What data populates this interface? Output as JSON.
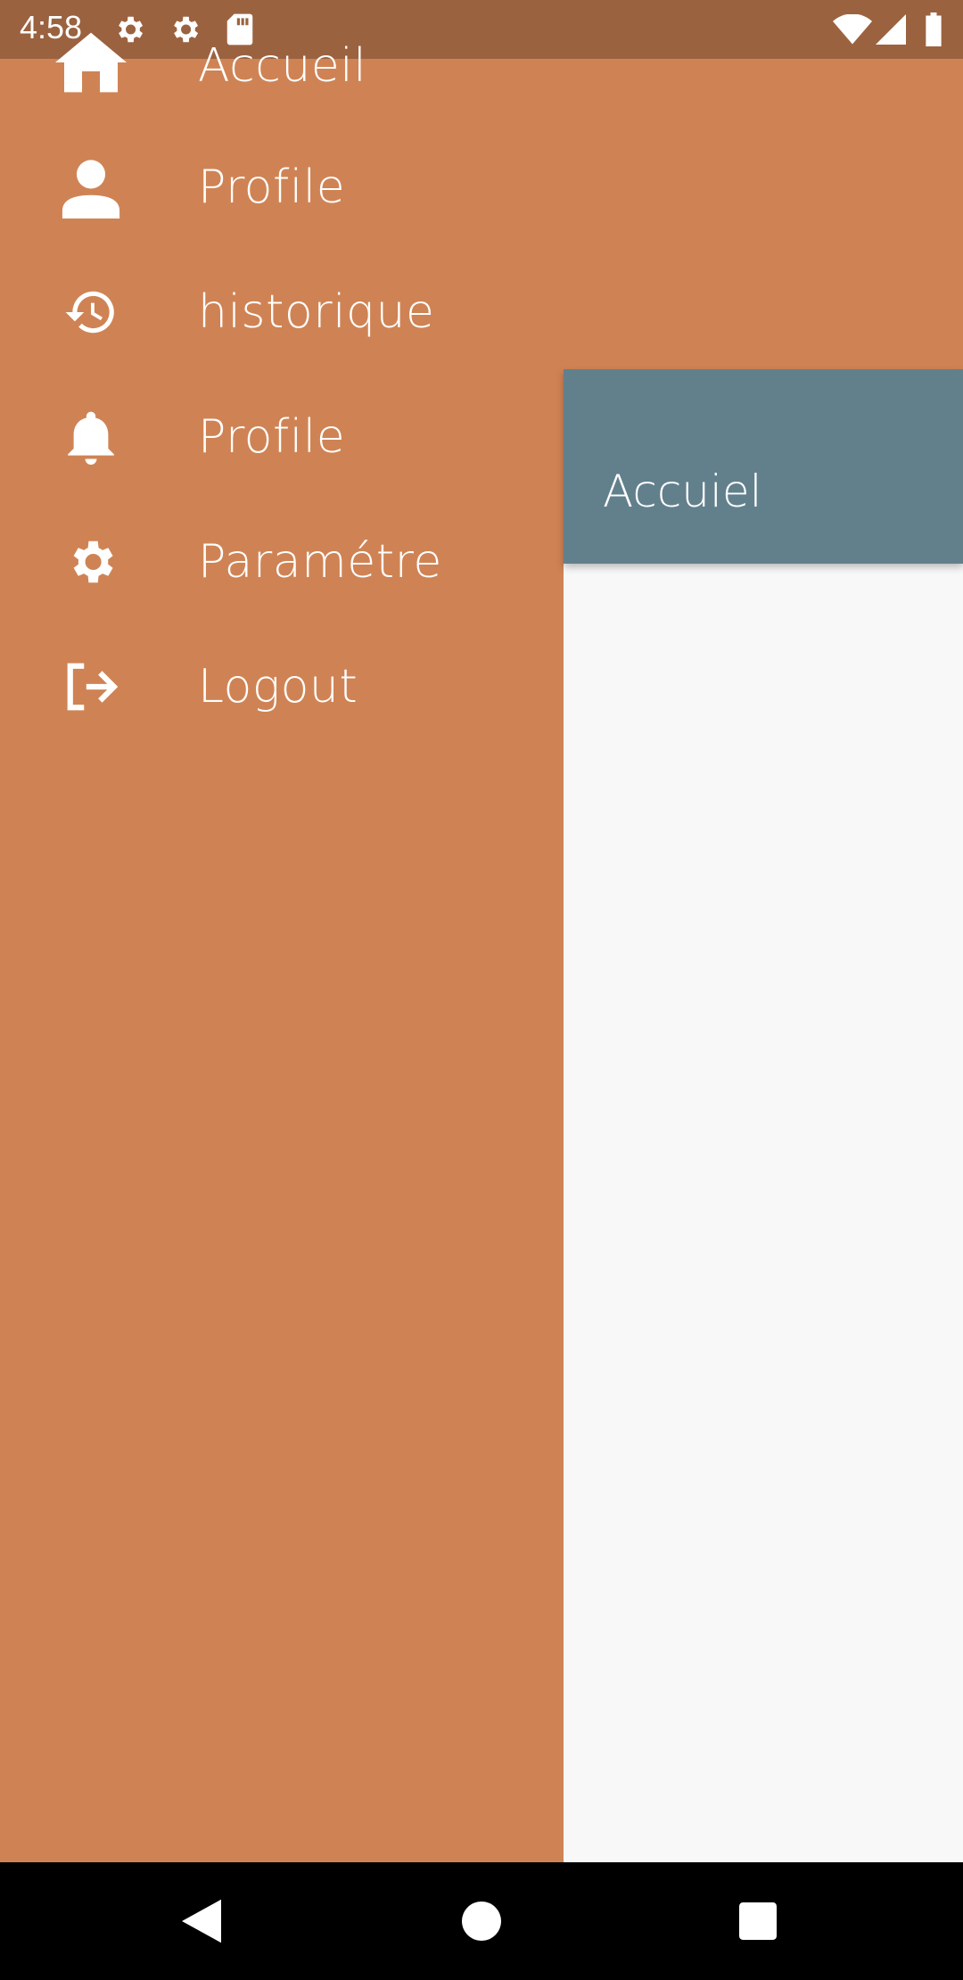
{
  "status_bar": {
    "time": "4:58",
    "left_icons": [
      "gear-icon",
      "gear-icon",
      "sd-card-icon"
    ],
    "right_icons": [
      "wifi-icon",
      "signal-icon",
      "battery-icon"
    ]
  },
  "drawer": {
    "background": "#cf8354",
    "items": [
      {
        "icon": "home-icon",
        "label": "Accueil"
      },
      {
        "icon": "person-icon",
        "label": "Profile"
      },
      {
        "icon": "history-icon",
        "label": "historique"
      },
      {
        "icon": "bell-icon",
        "label": "Profile"
      },
      {
        "icon": "gear-icon",
        "label": "Paramétre"
      },
      {
        "icon": "logout-icon",
        "label": "Logout"
      }
    ]
  },
  "main": {
    "appbar_title": "Accuiel",
    "appbar_color": "#62808c",
    "background": "#f8f8f8"
  },
  "nav_bar": {
    "buttons": [
      "back-icon",
      "home-circle-icon",
      "recents-icon"
    ]
  }
}
